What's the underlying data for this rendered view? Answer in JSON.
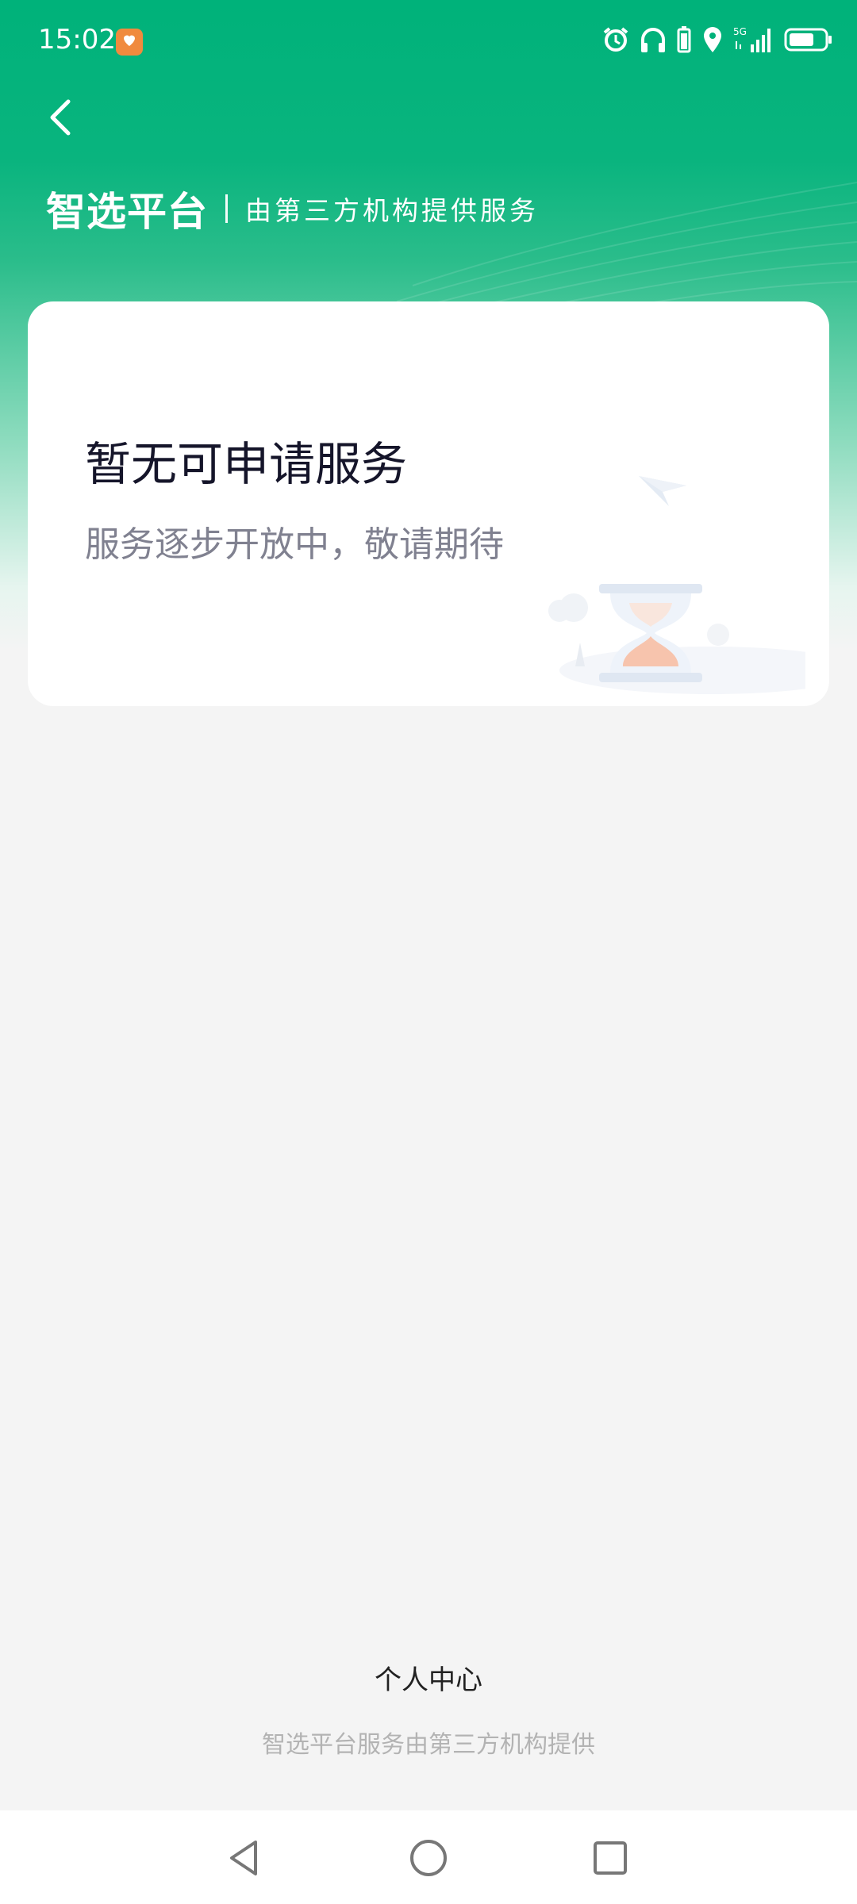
{
  "status_bar": {
    "time": "15:02",
    "icons": [
      "app-notification-icon",
      "alarm-icon",
      "headphones-icon",
      "battery-saver-icon",
      "location-icon",
      "5g-signal-icon",
      "battery-icon"
    ],
    "network": "5G"
  },
  "header": {
    "back_icon": "chevron-left-icon",
    "brand_title": "智选平台",
    "brand_subtitle": "由第三方机构提供服务",
    "accent_color": "#00b27a"
  },
  "empty_card": {
    "title": "暂无可申请服务",
    "subtitle": "服务逐步开放中，敬请期待",
    "illustration": "hourglass-icon"
  },
  "footer": {
    "personal_center_label": "个人中心",
    "note": "智选平台服务由第三方机构提供"
  },
  "nav_bar": {
    "buttons": [
      "back-triangle-icon",
      "home-circle-icon",
      "recents-square-icon"
    ]
  }
}
